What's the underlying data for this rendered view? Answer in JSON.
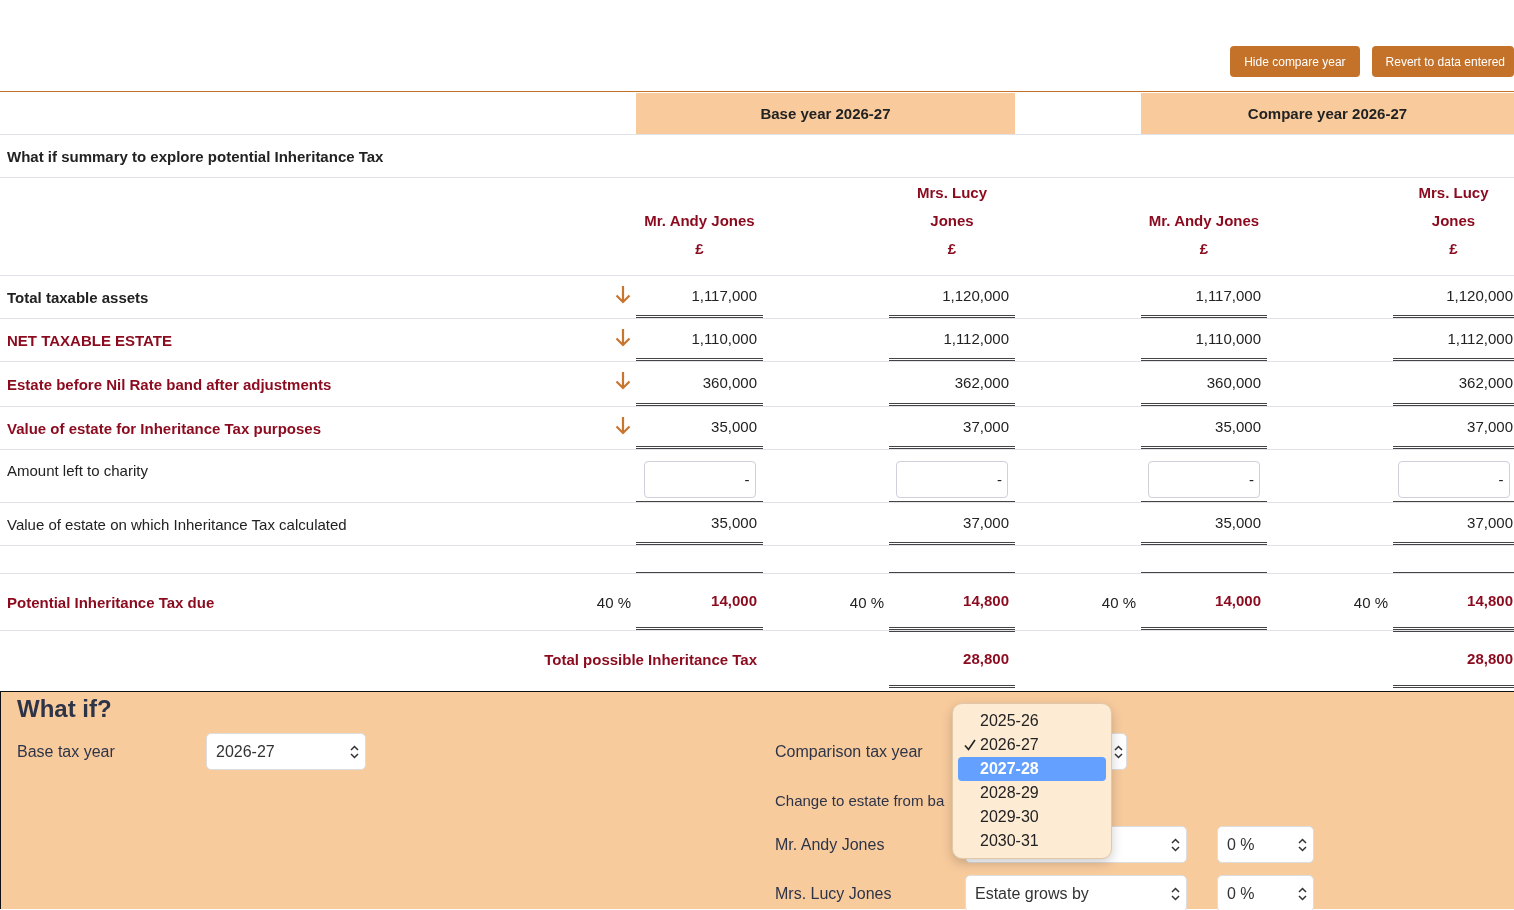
{
  "toolbar": {
    "buttons": [
      "Hide compare year",
      "Revert to data entered"
    ]
  },
  "table": {
    "year_headers": [
      {
        "label": "Base year 2026-27"
      },
      {
        "label": "Compare year 2026-27"
      }
    ],
    "summary_title": "What if summary to explore potential Inheritance Tax",
    "columns": [
      {
        "name": "Mr. Andy Jones",
        "currency": "£"
      },
      {
        "name": "Mrs. Lucy Jones",
        "currency": "£"
      },
      {
        "name": "Mr. Andy Jones",
        "currency": "£"
      },
      {
        "name": "Mrs. Lucy Jones",
        "currency": "£"
      }
    ],
    "rows": [
      {
        "kind": "arrow",
        "bold": true,
        "highlighted": false,
        "label": "Total taxable assets",
        "values": [
          "1,117,000",
          "1,120,000",
          "1,117,000",
          "1,120,000"
        ]
      },
      {
        "kind": "arrow",
        "bold": true,
        "highlighted": true,
        "label": "NET TAXABLE ESTATE",
        "values": [
          "1,110,000",
          "1,112,000",
          "1,110,000",
          "1,112,000"
        ]
      },
      {
        "kind": "arrow",
        "bold": true,
        "highlighted": true,
        "label": "Estate before Nil Rate band after adjustments",
        "values": [
          "360,000",
          "362,000",
          "360,000",
          "362,000"
        ]
      },
      {
        "kind": "arrow",
        "bold": true,
        "highlighted": true,
        "label": "Value of estate for Inheritance Tax purposes",
        "values": [
          "35,000",
          "37,000",
          "35,000",
          "37,000"
        ]
      },
      {
        "kind": "input",
        "bold": false,
        "highlighted": false,
        "label": "Amount left to charity",
        "values": [
          "-",
          "-",
          "-",
          "-"
        ]
      },
      {
        "kind": "plain",
        "bold": false,
        "highlighted": false,
        "label": "Value of estate on which Inheritance Tax calculated",
        "values": [
          "35,000",
          "37,000",
          "35,000",
          "37,000"
        ]
      },
      {
        "kind": "spacer"
      },
      {
        "kind": "tax",
        "bold": true,
        "highlighted": true,
        "label": "Potential Inheritance Tax due",
        "rates": [
          "40 %",
          "40 %",
          "40 %",
          "40 %"
        ],
        "values": [
          "14,000",
          "14,800",
          "14,000",
          "14,800"
        ]
      },
      {
        "kind": "total",
        "bold": true,
        "highlighted": true,
        "caption": "Total possible Inheritance Tax",
        "values": [
          "28,800",
          "28,800"
        ]
      }
    ]
  },
  "what_if": {
    "title": "What if?",
    "base_tax_year": {
      "label": "Base tax year",
      "value": "2026-27"
    },
    "comparison_tax_year": {
      "label": "Comparison tax year"
    },
    "change_label": "Change to estate from ba",
    "people": [
      {
        "label": "Mr. Andy Jones",
        "percent": "0 %"
      },
      {
        "label": "Mrs. Lucy Jones",
        "change": {
          "value": "Estate grows by"
        },
        "percent": "0 %"
      }
    ],
    "year_dropdown": [
      {
        "label": "2025-26",
        "checked": false,
        "selected": false
      },
      {
        "label": "2026-27",
        "checked": true,
        "selected": false
      },
      {
        "label": "2027-28",
        "checked": false,
        "selected": true
      },
      {
        "label": "2028-29",
        "checked": false,
        "selected": false
      },
      {
        "label": "2029-30",
        "checked": false,
        "selected": false
      },
      {
        "label": "2030-31",
        "checked": false,
        "selected": false
      }
    ]
  }
}
